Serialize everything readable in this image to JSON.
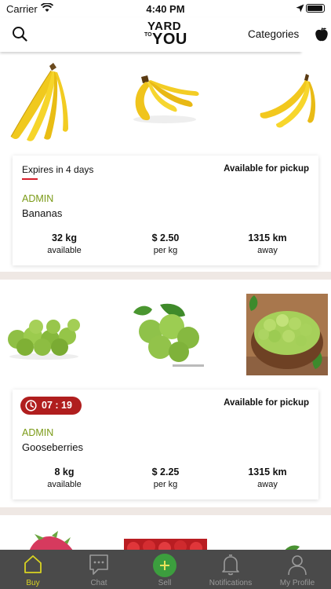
{
  "status_bar": {
    "carrier": "Carrier",
    "time": "4:40 PM"
  },
  "header": {
    "logo_top": "YARD",
    "logo_mid": "TO",
    "logo_bottom": "YOU",
    "categories_label": "Categories"
  },
  "listings": [
    {
      "images": [
        "banana-bunch-photo",
        "banana-hand-photo",
        "banana-pair-photo"
      ],
      "badge_type": "expiry",
      "expiry_text": "Expires in 4 days",
      "pickup": "Available for pickup",
      "seller": "ADMIN",
      "product": "Bananas",
      "stats": [
        {
          "value": "32 kg",
          "unit": "available"
        },
        {
          "value": "$ 2.50",
          "unit": "per kg"
        },
        {
          "value": "1315 km",
          "unit": "away"
        }
      ]
    },
    {
      "images": [
        "gooseberries-pile-photo",
        "gooseberries-leaf-photo",
        "gooseberries-bowl-photo"
      ],
      "badge_type": "timer",
      "timer": "07 : 19",
      "pickup": "Available for pickup",
      "seller": "ADMIN",
      "product": "Gooseberries",
      "stats": [
        {
          "value": "8 kg",
          "unit": "available"
        },
        {
          "value": "$ 2.25",
          "unit": "per kg"
        },
        {
          "value": "1315 km",
          "unit": "away"
        }
      ]
    }
  ],
  "tabs": [
    {
      "label": "Buy",
      "icon": "home-icon",
      "active": true
    },
    {
      "label": "Chat",
      "icon": "chat-icon",
      "active": false
    },
    {
      "label": "Sell",
      "icon": "plus-icon",
      "active": false
    },
    {
      "label": "Notifications",
      "icon": "bell-icon",
      "active": false
    },
    {
      "label": "My Profile",
      "icon": "user-icon",
      "active": false
    }
  ],
  "colors": {
    "accent_green": "#7a9a16",
    "timer_red": "#b01e1e",
    "tab_active": "#d9d322",
    "tabbar_bg": "#4a4a4a"
  }
}
